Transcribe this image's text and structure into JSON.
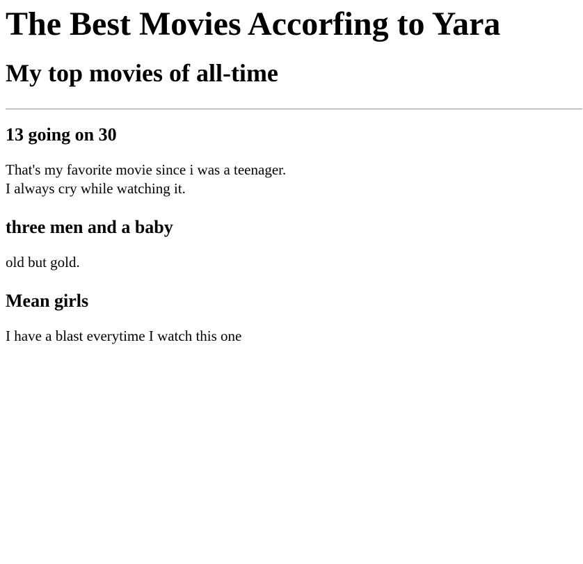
{
  "header": {
    "title": "The Best Movies Accorfing to Yara",
    "subtitle": "My top movies of all-time"
  },
  "movies": [
    {
      "title": "13 going on 30",
      "lines": [
        "That's my favorite movie since i was a teenager.",
        "I always cry while watching it."
      ]
    },
    {
      "title": "three men and a baby",
      "lines": [
        "old but gold."
      ]
    },
    {
      "title": "Mean girls",
      "lines": [
        "I have a blast everytime I watch this one"
      ]
    }
  ]
}
